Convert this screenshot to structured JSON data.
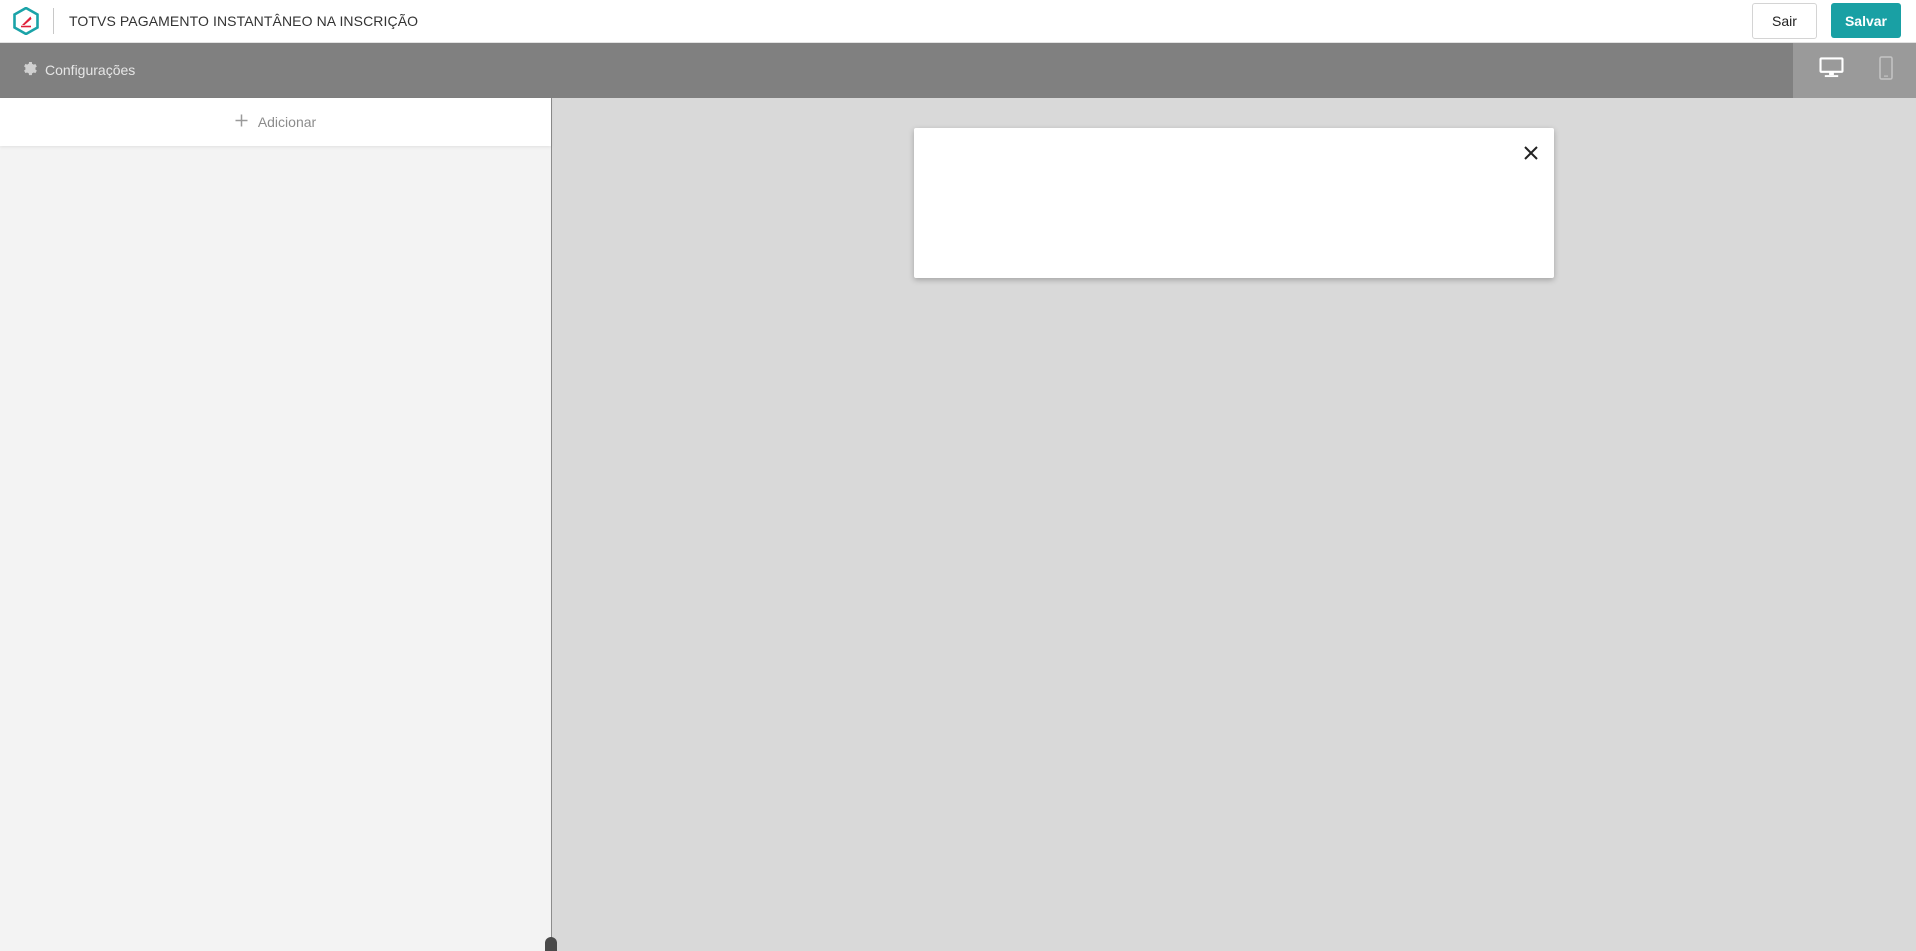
{
  "header": {
    "logo_icon": "totvs-logo-icon",
    "title": "TOTVS PAGAMENTO INSTANTÂNEO NA INSCRIÇÃO",
    "exit_label": "Sair",
    "save_label": "Salvar"
  },
  "toolbar": {
    "settings_label": "Configurações",
    "settings_icon": "gear-icon",
    "devices": [
      {
        "name": "desktop",
        "icon": "desktop-icon",
        "active": true
      },
      {
        "name": "mobile",
        "icon": "mobile-icon",
        "active": false
      }
    ]
  },
  "sidebar": {
    "add_label": "Adicionar",
    "add_icon": "plus-icon"
  },
  "modal": {
    "close_icon": "close-icon"
  },
  "colors": {
    "accent": "#19a0a4",
    "toolbar_bg": "#808080",
    "canvas_bg": "#d9d9d9",
    "panel_bg": "#f3f3f3"
  }
}
